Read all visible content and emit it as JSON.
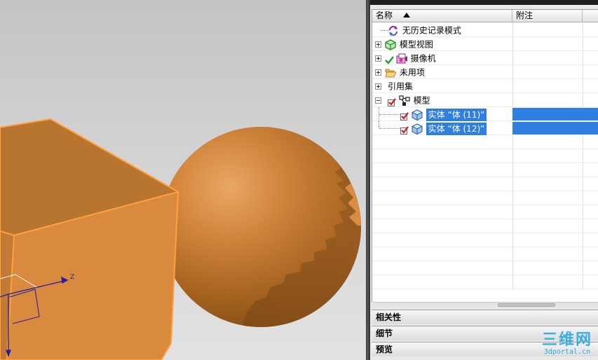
{
  "navigator": {
    "columns": {
      "name": "名称",
      "note": "附注"
    },
    "rows": [
      {
        "label": "无历史记录模式",
        "icon": "refresh-history-icon",
        "expander": "none",
        "checked": false,
        "selected": false
      },
      {
        "label": "模型视图",
        "icon": "model-views-icon",
        "expander": "plus",
        "checked": false,
        "selected": false
      },
      {
        "label": "摄像机",
        "icon": "camera-icon",
        "expander": "plus",
        "checked": true,
        "selected": false
      },
      {
        "label": "未用项",
        "icon": "folder-open-icon",
        "expander": "plus",
        "checked": false,
        "selected": false
      },
      {
        "label": "引用集",
        "icon": "",
        "expander": "plus",
        "checked": false,
        "selected": false
      },
      {
        "label": "模型",
        "icon": "model-assembly-icon",
        "expander": "minus",
        "checked": true,
        "selected": false
      },
      {
        "label": "实体 “体 (11)”",
        "icon": "solid-body-icon",
        "expander": "none",
        "checked": true,
        "selected": true
      },
      {
        "label": "实体 “体 (12)”",
        "icon": "solid-body-icon",
        "expander": "none",
        "checked": true,
        "selected": true
      }
    ],
    "sections": {
      "relations": "相关性",
      "details": "细节",
      "preview": "预览"
    }
  },
  "viewport": {
    "axis_label": "Z",
    "objects": [
      "box",
      "sphere"
    ]
  },
  "watermark": {
    "logo": "三维网",
    "url": "3dportal.cn"
  },
  "colors": {
    "selection": "#2f7fe0",
    "body_orange": "#d98a3e",
    "highlight_edge": "#ffa040",
    "axis_blue": "#2020a0",
    "watermark": "#2ba8df"
  }
}
